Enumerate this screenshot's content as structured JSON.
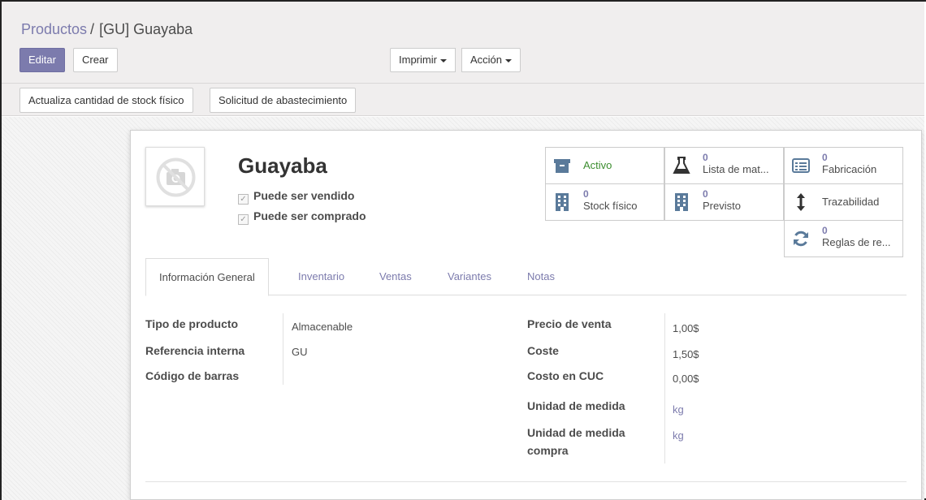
{
  "breadcrumb": {
    "parent": "Productos",
    "separator": "/",
    "current": "[GU] Guayaba"
  },
  "toolbar": {
    "edit_label": "Editar",
    "create_label": "Crear",
    "print_label": "Imprimir",
    "action_label": "Acción"
  },
  "statusbar": {
    "update_stock_label": "Actualiza cantidad de stock físico",
    "procurement_label": "Solicitud de abastecimiento"
  },
  "product": {
    "name": "Guayaba",
    "can_be_sold_label": "Puede ser vendido",
    "can_be_sold": true,
    "can_be_purchased_label": "Puede ser comprado",
    "can_be_purchased": true
  },
  "smart_buttons": {
    "active": {
      "label": "Activo",
      "icon": "archive-icon",
      "color": "#3c8d2f"
    },
    "bom": {
      "value": "0",
      "label": "Lista de mat...",
      "icon": "flask-icon"
    },
    "manufacturing": {
      "value": "0",
      "label": "Fabricación",
      "icon": "list-icon"
    },
    "stock": {
      "value": "0",
      "label": "Stock físico",
      "icon": "building-icon"
    },
    "forecast": {
      "value": "0",
      "label": "Previsto",
      "icon": "building-icon"
    },
    "traceability": {
      "label": "Trazabilidad",
      "icon": "arrows-vertical-icon"
    },
    "reorder_rules": {
      "value": "0",
      "label": "Reglas de re...",
      "icon": "refresh-icon"
    }
  },
  "tabs": [
    {
      "label": "Información General",
      "active": true
    },
    {
      "label": "Inventario",
      "active": false
    },
    {
      "label": "Ventas",
      "active": false
    },
    {
      "label": "Variantes",
      "active": false
    },
    {
      "label": "Notas",
      "active": false
    }
  ],
  "general_info": {
    "left": [
      {
        "label": "Tipo de producto",
        "value": "Almacenable"
      },
      {
        "label": "Referencia interna",
        "value": "GU"
      },
      {
        "label": "Código de barras",
        "value": ""
      }
    ],
    "right": [
      {
        "label": "Precio de venta",
        "value": "1,00$"
      },
      {
        "label": "Coste",
        "value": "1,50$"
      },
      {
        "label": "Costo en CUC",
        "value": "0,00$"
      },
      {
        "label": "Unidad de medida",
        "value": "kg"
      },
      {
        "label_line1": "Unidad de medida",
        "label_line2": "compra",
        "value": "kg"
      }
    ]
  },
  "colors": {
    "primary": "#7c7bad",
    "active_green": "#3c8d2f",
    "text": "#4c4c4c"
  }
}
